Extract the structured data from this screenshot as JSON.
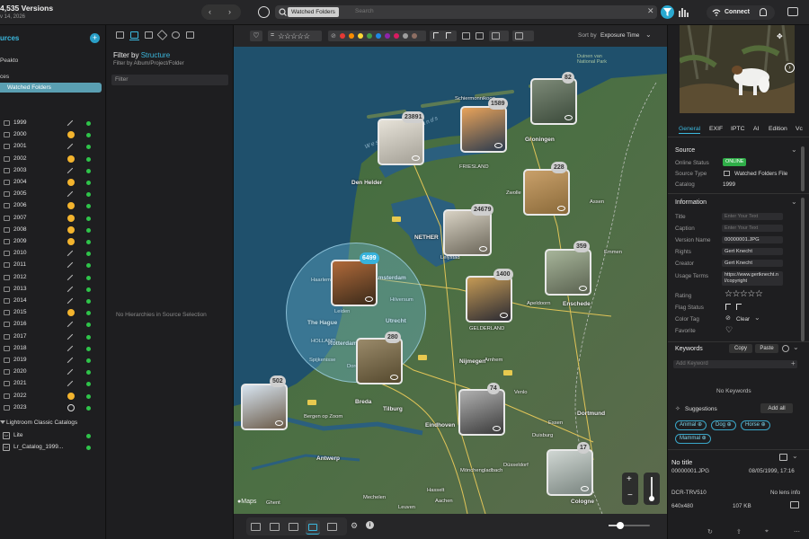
{
  "topbar": {
    "versions": "4,535 Versions",
    "date": "v 14, 2026",
    "source_chip": "Watched Folders",
    "search_placeholder": "Search",
    "connect": "Connect"
  },
  "sources": {
    "title": "urces",
    "row1": "Peakto",
    "row2": "ces",
    "selected": "Watched Folders",
    "years": [
      {
        "label": "1999",
        "status": "link"
      },
      {
        "label": "2000",
        "status": "warn"
      },
      {
        "label": "2001",
        "status": "link"
      },
      {
        "label": "2002",
        "status": "warn"
      },
      {
        "label": "2003",
        "status": "link"
      },
      {
        "label": "2004",
        "status": "warn"
      },
      {
        "label": "2005",
        "status": "link"
      },
      {
        "label": "2006",
        "status": "warn"
      },
      {
        "label": "2007",
        "status": "warn"
      },
      {
        "label": "2008",
        "status": "warn"
      },
      {
        "label": "2009",
        "status": "warn"
      },
      {
        "label": "2010",
        "status": "link"
      },
      {
        "label": "2011",
        "status": "link"
      },
      {
        "label": "2012",
        "status": "link"
      },
      {
        "label": "2013",
        "status": "link"
      },
      {
        "label": "2014",
        "status": "link"
      },
      {
        "label": "2015",
        "status": "warn"
      },
      {
        "label": "2016",
        "status": "link"
      },
      {
        "label": "2017",
        "status": "link"
      },
      {
        "label": "2018",
        "status": "link"
      },
      {
        "label": "2019",
        "status": "link"
      },
      {
        "label": "2020",
        "status": "link"
      },
      {
        "label": "2021",
        "status": "link"
      },
      {
        "label": "2022",
        "status": "warn"
      },
      {
        "label": "2023",
        "status": "ring"
      }
    ],
    "lightroom_title": "Lightroom Classic Catalogs",
    "catalogs": [
      "Lite",
      "Lr_Catalog_1999..."
    ]
  },
  "filter": {
    "title_prefix": "Filter by",
    "title_link": "Structure",
    "subtitle": "Filter by Album/Project/Folder",
    "input_placeholder": "Filter",
    "empty": "No Hierarchies in Source Selection"
  },
  "toolbar": {
    "rating_prefix": "=",
    "stars": "☆☆☆☆☆",
    "sort_label": "Sort by",
    "sort_value": "Exposure Time",
    "label_colors": [
      "#e53935",
      "#fb8c00",
      "#fdd835",
      "#43a047",
      "#1e88e5",
      "#8e24aa",
      "#d81b60",
      "#9e9e9e",
      "#8d6e63"
    ]
  },
  "map": {
    "water_label_1": "West Frisian Islands",
    "water_label_2": "National Park",
    "water_label_3": "Duinen van",
    "maps_credit": "Maps",
    "cities": [
      {
        "name": "Schiermonnikoog",
        "cls": "s"
      },
      {
        "name": "Groningen",
        "cls": ""
      },
      {
        "name": "Den Helder",
        "cls": ""
      },
      {
        "name": "FRIESLAND",
        "cls": "s"
      },
      {
        "name": "Assen",
        "cls": "s"
      },
      {
        "name": "Emmen",
        "cls": "s"
      },
      {
        "name": "NETHER",
        "cls": ""
      },
      {
        "name": "Lelystad",
        "cls": "s"
      },
      {
        "name": "Amsterdam",
        "cls": ""
      },
      {
        "name": "Haarlem",
        "cls": "s"
      },
      {
        "name": "Leiden",
        "cls": "s"
      },
      {
        "name": "Hilversum",
        "cls": "s"
      },
      {
        "name": "Utrecht",
        "cls": ""
      },
      {
        "name": "The Hague",
        "cls": ""
      },
      {
        "name": "Rotterdam",
        "cls": ""
      },
      {
        "name": "HOLLAND",
        "cls": "s"
      },
      {
        "name": "Spijkenisse",
        "cls": "s"
      },
      {
        "name": "Dordrecht",
        "cls": "s"
      },
      {
        "name": "Nijmegen",
        "cls": ""
      },
      {
        "name": "GELDERLAND",
        "cls": "s"
      },
      {
        "name": "Enschede",
        "cls": ""
      },
      {
        "name": "Breda",
        "cls": ""
      },
      {
        "name": "Tilburg",
        "cls": ""
      },
      {
        "name": "Eindhoven",
        "cls": ""
      },
      {
        "name": "Dortmund",
        "cls": ""
      },
      {
        "name": "Duisburg",
        "cls": "s"
      },
      {
        "name": "Essen",
        "cls": "s"
      },
      {
        "name": "Antwerp",
        "cls": ""
      },
      {
        "name": "Bergen op Zoom",
        "cls": "s"
      },
      {
        "name": "Mönchengladbach",
        "cls": "s"
      },
      {
        "name": "Düsseldorf",
        "cls": "s"
      },
      {
        "name": "Cologne",
        "cls": ""
      },
      {
        "name": "Aachen",
        "cls": "s"
      },
      {
        "name": "Ghent",
        "cls": "s"
      },
      {
        "name": "Zwolle",
        "cls": "s"
      },
      {
        "name": "Apeldoorn",
        "cls": "s"
      },
      {
        "name": "Arnhem",
        "cls": "s"
      },
      {
        "name": "Venlo",
        "cls": "s"
      },
      {
        "name": "Hasselt",
        "cls": "s"
      },
      {
        "name": "Mechelen",
        "cls": "s"
      },
      {
        "name": "Leuven",
        "cls": "s"
      }
    ],
    "clusters": [
      {
        "count": "82"
      },
      {
        "count": "1589"
      },
      {
        "count": "23891"
      },
      {
        "count": "228"
      },
      {
        "count": "24679"
      },
      {
        "count": "359"
      },
      {
        "count": "6499"
      },
      {
        "count": "1400"
      },
      {
        "count": "280"
      },
      {
        "count": "502"
      },
      {
        "count": "74"
      },
      {
        "count": "17"
      }
    ]
  },
  "inspector": {
    "tabs": [
      "General",
      "EXIF",
      "IPTC",
      "AI",
      "Edition",
      "Vc"
    ],
    "source_title": "Source",
    "online_status_label": "Online Status",
    "online_status_value": "ONLINE",
    "source_type_label": "Source Type",
    "source_type_value": "Watched Folders File",
    "catalog_label": "Catalog",
    "catalog_value": "1999",
    "information_title": "Information",
    "title_label": "Title",
    "title_placeholder": "Enter Your Text",
    "caption_label": "Caption",
    "caption_placeholder": "Enter Your Text",
    "version_label": "Version Name",
    "version_value": "00000001.JPG",
    "rights_label": "Rights",
    "rights_value": "Gert Knecht",
    "creator_label": "Creator",
    "creator_value": "Gert Knecht",
    "usage_label": "Usage Terms",
    "usage_value": "https://www.gertknecht.nl/copyright",
    "rating_label": "Rating",
    "rating_value": "☆☆☆☆☆",
    "flag_label": "Flag Status",
    "color_label": "Color Tag",
    "color_value": "Clear",
    "favorite_label": "Favorite",
    "keywords_title": "Keywords",
    "copy": "Copy",
    "paste": "Paste",
    "add_keyword_placeholder": "Add Keyword",
    "no_keywords": "No Keywords",
    "suggestions": "Suggestions",
    "add_all": "Add all",
    "suggest_tags": [
      "Animal",
      "Dog",
      "Horse",
      "Mammal"
    ],
    "footer_title": "No title",
    "footer_file": "00000001.JPG",
    "footer_date": "08/05/1999, 17:16",
    "camera": "DCR-TRV510",
    "lens": "No lens info",
    "dimensions": "640x480",
    "filesize": "107 KB"
  }
}
